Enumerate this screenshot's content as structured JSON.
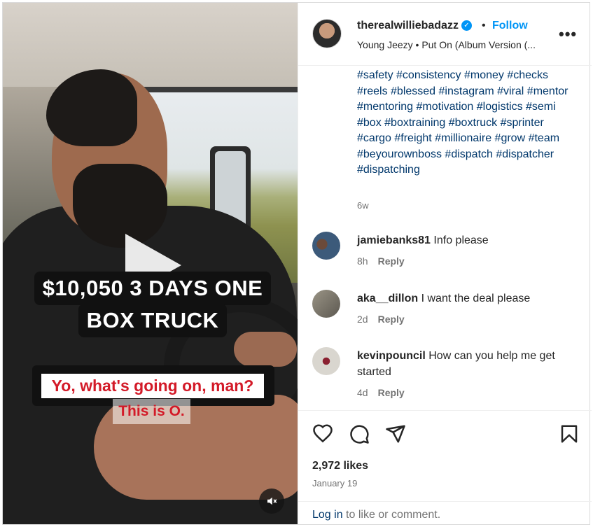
{
  "post": {
    "username": "therealwilliebadazz",
    "follow_label": "Follow",
    "dot": "•",
    "audio": "Young Jeezy • Put On (Album Version (...",
    "more_label": "•••"
  },
  "video": {
    "overlay_line1": "$10,050 3 DAYS ONE",
    "overlay_line2": "BOX TRUCK",
    "caption_main": "Yo, what's going on, man?",
    "caption_sub": "This is O.",
    "mute_icon": "speaker-muted-icon"
  },
  "caption": {
    "hashtags": "#safety #consistency #money #checks #reels #blessed #instagram #viral #mentor #mentoring #motivation #logistics #semi #box #boxtraining #boxtruck #sprinter #cargo #freight #millionaire #grow #team #beyourownboss #dispatch #dispatcher #dispatching",
    "time": "6w"
  },
  "comments": [
    {
      "user": "jamiebanks81",
      "text": "Info please",
      "time": "8h",
      "reply": "Reply"
    },
    {
      "user": "aka__dillon",
      "text": "I want the deal please",
      "time": "2d",
      "reply": "Reply"
    },
    {
      "user": "kevinpouncil",
      "text": "How can you help me get started",
      "time": "4d",
      "reply": "Reply"
    }
  ],
  "actions": {
    "likes": "2,972 likes",
    "date": "January 19"
  },
  "footer": {
    "login_link": "Log in",
    "login_rest": " to like or comment."
  },
  "colors": {
    "accent": "#0095f6",
    "link": "#00376b",
    "muted": "#737373",
    "caption_red": "#d31a28"
  }
}
